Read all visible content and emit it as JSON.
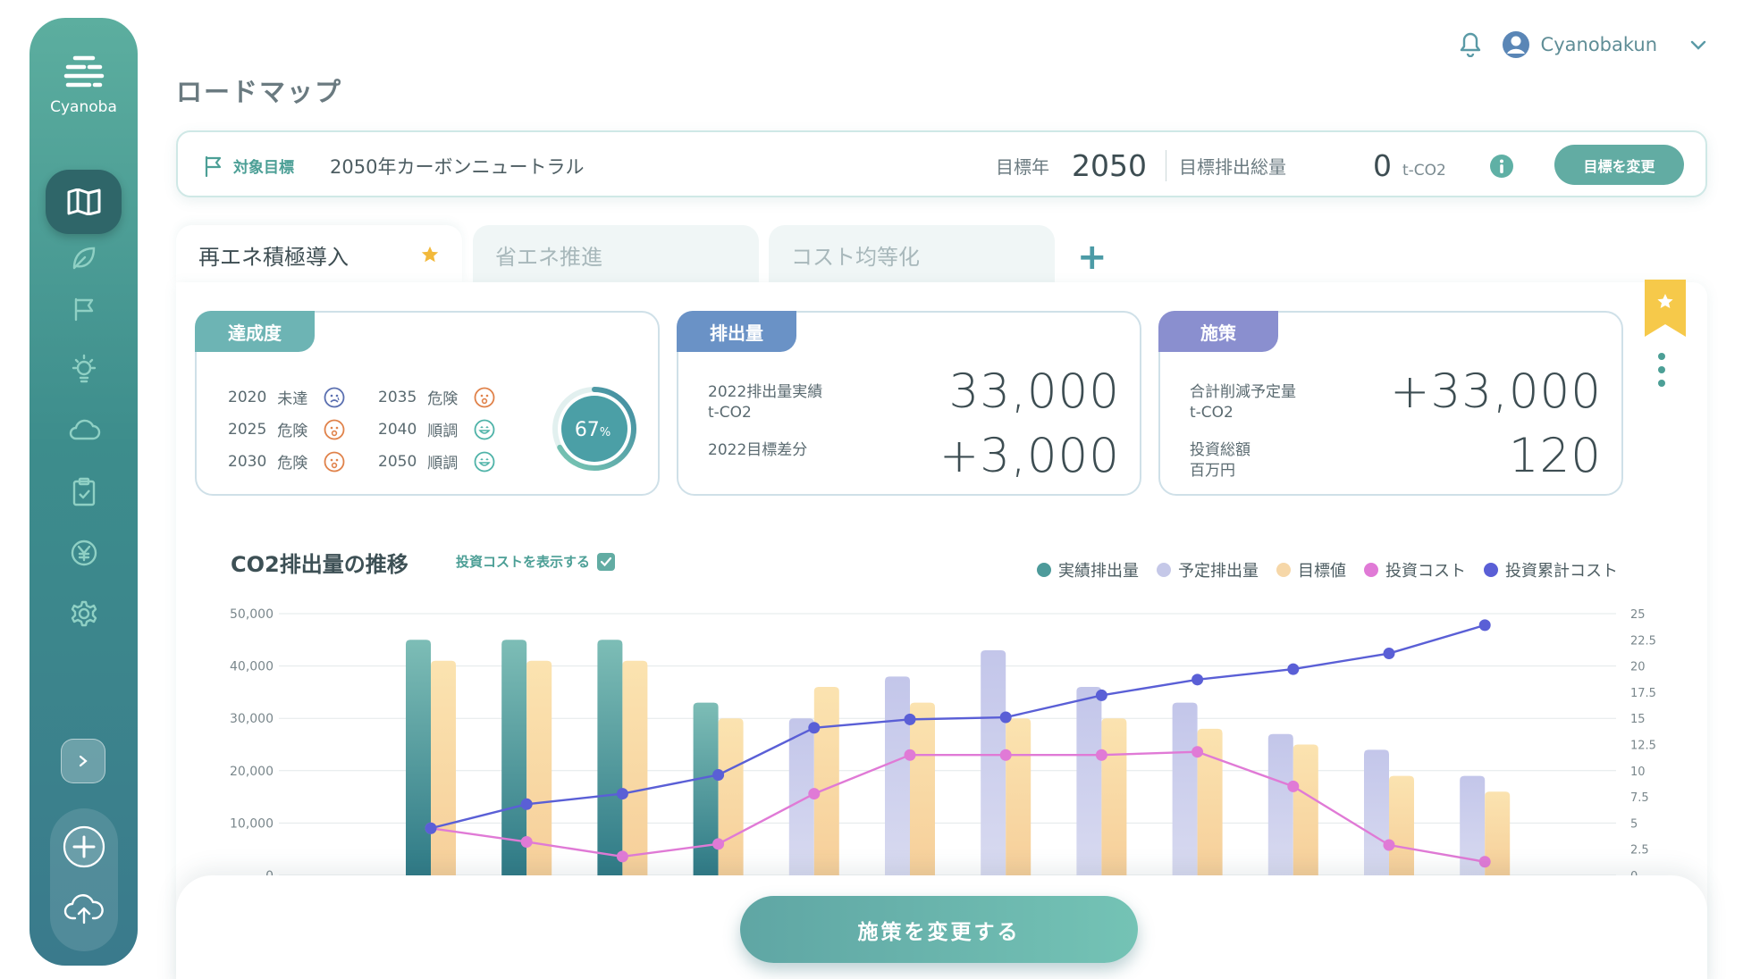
{
  "app": {
    "brand": "Cyanoba"
  },
  "page": {
    "title": "ロードマップ"
  },
  "user": {
    "name": "Cyanobakun"
  },
  "goal": {
    "label": "対象目標",
    "text": "2050年カーボンニュートラル",
    "year_label": "目標年",
    "year_value": "2050",
    "total_label": "目標排出総量",
    "total_value": "0",
    "total_unit": "t-CO2",
    "change_button": "目標を変更"
  },
  "tabs": [
    {
      "label": "再エネ積極導入",
      "active": true,
      "starred": true
    },
    {
      "label": "省エネ推進",
      "active": false
    },
    {
      "label": "コスト均等化",
      "active": false
    }
  ],
  "achievement": {
    "title": "達成度",
    "percent": 67,
    "percent_text": "67",
    "percent_unit": "%",
    "rows": [
      {
        "year": "2020",
        "status": "未達",
        "face": "sad"
      },
      {
        "year": "2025",
        "status": "危険",
        "face": "shock"
      },
      {
        "year": "2030",
        "status": "危険",
        "face": "shock"
      },
      {
        "year": "2035",
        "status": "危険",
        "face": "shock"
      },
      {
        "year": "2040",
        "status": "順調",
        "face": "happy"
      },
      {
        "year": "2050",
        "status": "順調",
        "face": "happy"
      }
    ]
  },
  "emissions": {
    "title": "排出量",
    "label1": "2022排出量実績",
    "label1_unit": "t-CO2",
    "value1": "33,000",
    "label2": "2022目標差分",
    "value2": "+3,000"
  },
  "measures": {
    "title": "施策",
    "label1": "合計削減予定量",
    "label1_unit": "t-CO2",
    "value1": "+33,000",
    "label2": "投資総額",
    "label2_unit": "百万円",
    "value2": "120"
  },
  "chart": {
    "title": "CO2排出量の推移",
    "toggle_label": "投資コストを表示する",
    "toggle_checked": true,
    "legend": [
      {
        "name": "実績排出量",
        "color": "#4d9a9a"
      },
      {
        "name": "予定排出量",
        "color": "#c5c8e8"
      },
      {
        "name": "目標値",
        "color": "#f6d7a8"
      },
      {
        "name": "投資コスト",
        "color": "#e07ad6"
      },
      {
        "name": "投資累計コスト",
        "color": "#5a5fd6"
      }
    ]
  },
  "chart_data": {
    "type": "bar",
    "y_left": {
      "ticks": [
        "0",
        "10,000",
        "20,000",
        "30,000",
        "40,000",
        "50,000"
      ],
      "ylim": [
        0,
        50000
      ]
    },
    "y_right": {
      "ticks": [
        "0",
        "2.5",
        "5",
        "7.5",
        "10",
        "12.5",
        "15",
        "17.5",
        "20",
        "22.5",
        "25"
      ],
      "ylim": [
        0,
        25
      ]
    },
    "series": [
      {
        "name": "実績排出量",
        "type": "bar",
        "values": [
          45000,
          45000,
          45000,
          33000,
          null,
          null,
          null,
          null,
          null,
          null,
          null,
          null
        ]
      },
      {
        "name": "予定排出量",
        "type": "bar",
        "values": [
          null,
          null,
          null,
          null,
          30000,
          38000,
          43000,
          36000,
          33000,
          27000,
          24000,
          19000
        ]
      },
      {
        "name": "目標値",
        "type": "bar",
        "values": [
          41000,
          41000,
          41000,
          30000,
          36000,
          33000,
          30000,
          30000,
          28000,
          25000,
          19000,
          16000
        ]
      },
      {
        "name": "投資コスト",
        "type": "line",
        "axis": "right",
        "values": [
          4.5,
          3.2,
          1.8,
          3.0,
          7.8,
          11.5,
          11.5,
          11.5,
          11.8,
          8.5,
          2.9,
          1.3
        ]
      },
      {
        "name": "投資累計コスト",
        "type": "line",
        "axis": "right",
        "values": [
          4.5,
          6.8,
          7.8,
          9.6,
          14.1,
          14.9,
          15.1,
          17.2,
          18.7,
          19.7,
          21.2,
          23.9
        ]
      }
    ]
  },
  "cta": {
    "label": "施策を変更する"
  }
}
